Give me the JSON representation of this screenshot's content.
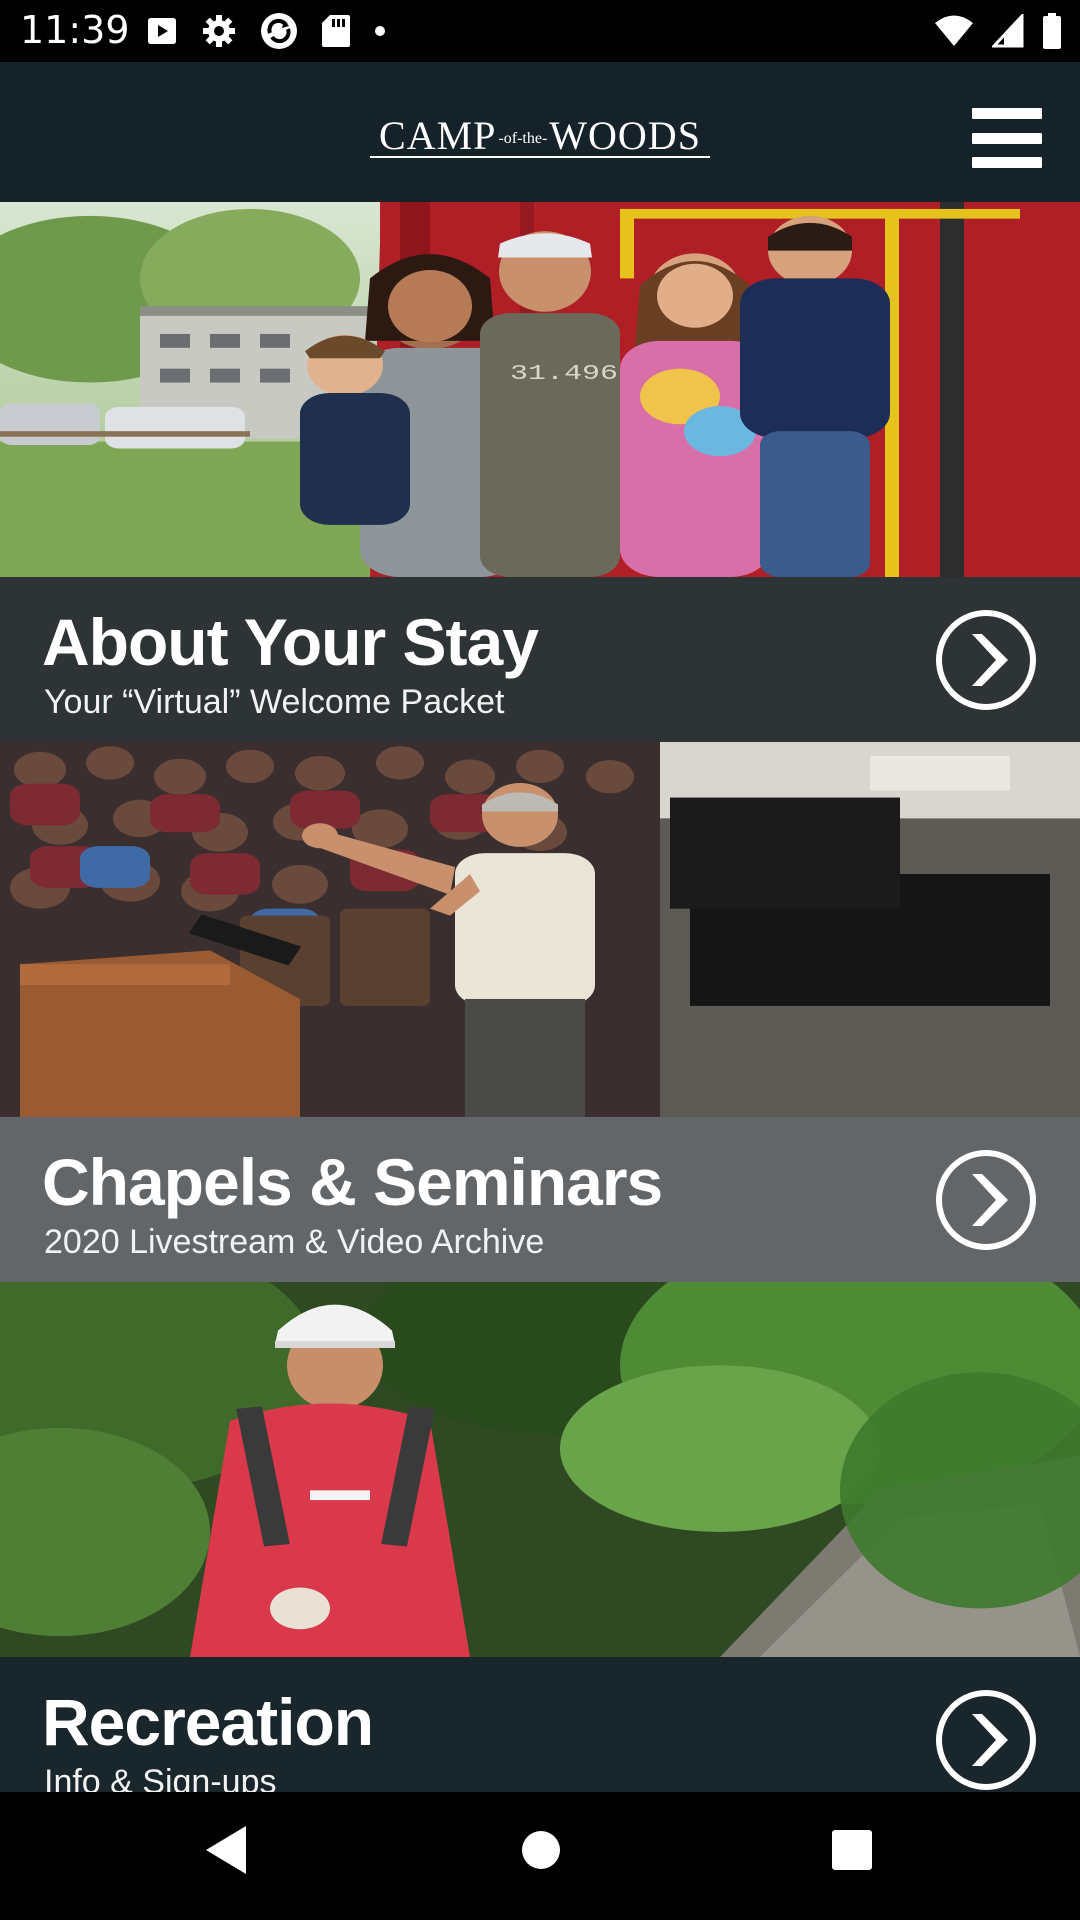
{
  "status_bar": {
    "time": "11:39",
    "left_icons": [
      "play-store-icon",
      "settings-gear-icon",
      "sync-icon",
      "sd-card-icon",
      "notification-dot-icon"
    ],
    "right_icons": [
      "wifi-icon",
      "cellular-signal-icon",
      "battery-icon"
    ]
  },
  "header": {
    "logo_main_left": "CAMP",
    "logo_small": "-of-the-",
    "logo_main_right": "WOODS",
    "menu_icon": "hamburger-menu-icon",
    "background_color": "#16222a"
  },
  "cards": [
    {
      "title": "About Your Stay",
      "subtitle": "Your “Virtual” Welcome Packet",
      "image": "family-photo-by-red-caboose",
      "arrow_icon": "chevron-right-circle-icon"
    },
    {
      "title": "Chapels & Seminars",
      "subtitle": "2020 Livestream & Video Archive",
      "image": "speaker-in-chapel-photo",
      "arrow_icon": "chevron-right-circle-icon"
    },
    {
      "title": "Recreation",
      "subtitle": "Info & Sign-ups",
      "image": "climber-in-forest-photo",
      "arrow_icon": "chevron-right-circle-icon"
    }
  ],
  "nav_bar": {
    "back_icon": "back-triangle-icon",
    "home_icon": "home-circle-icon",
    "recents_icon": "recents-square-icon"
  }
}
